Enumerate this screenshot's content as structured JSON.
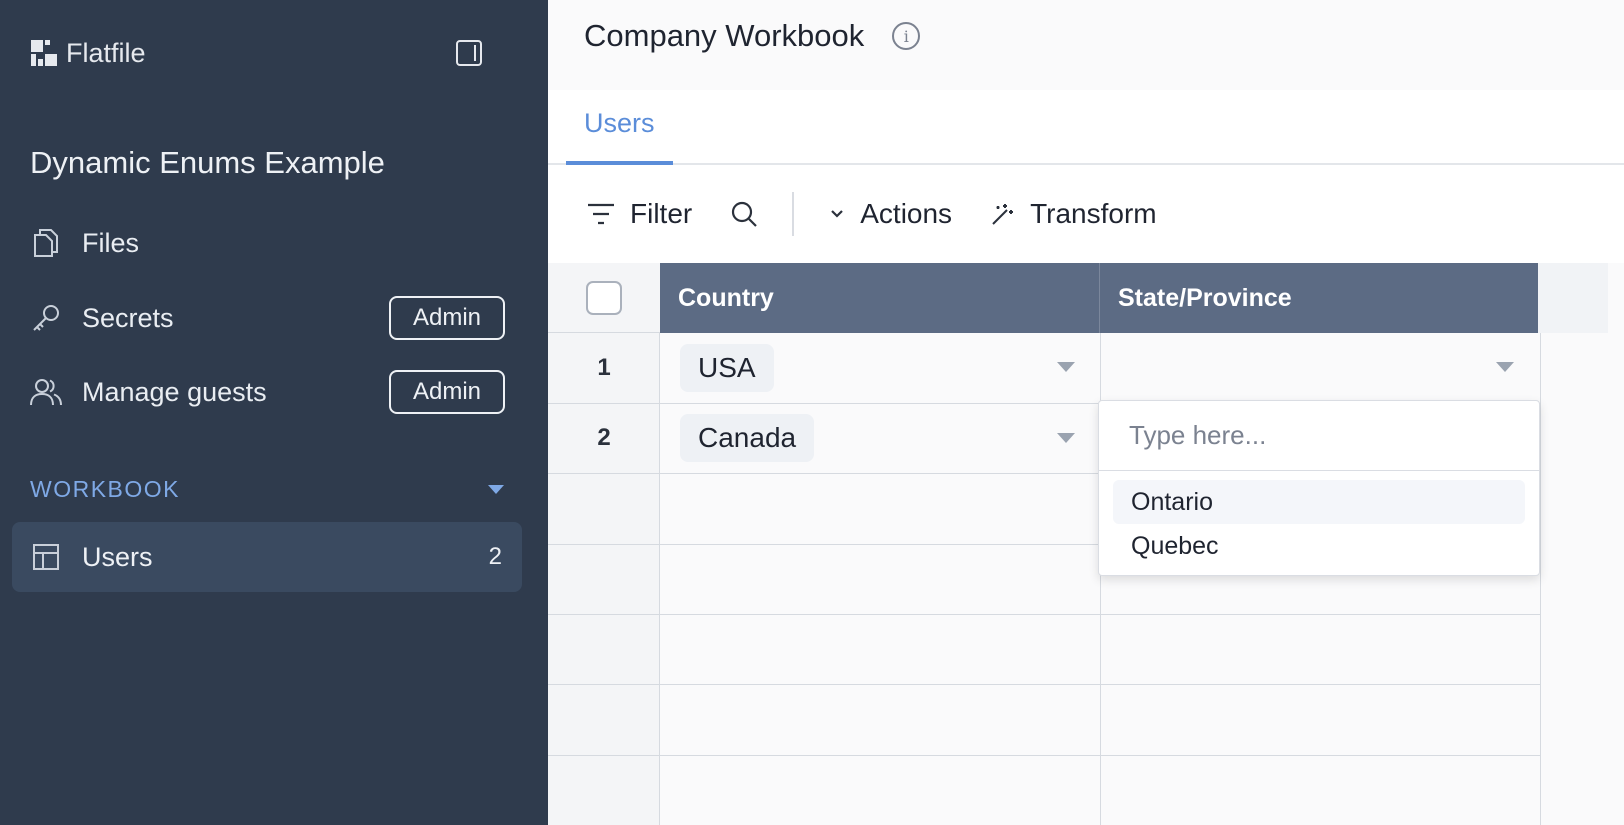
{
  "brand": {
    "name": "Flatfile"
  },
  "sidebar": {
    "space_title": "Dynamic Enums Example",
    "items": [
      {
        "label": "Files",
        "icon": "files-icon"
      },
      {
        "label": "Secrets",
        "icon": "key-icon",
        "badge": "Admin"
      },
      {
        "label": "Manage guests",
        "icon": "users-icon",
        "badge": "Admin"
      }
    ],
    "section": {
      "label": "WORKBOOK"
    },
    "sheets": [
      {
        "label": "Users",
        "count": "2",
        "icon": "table-icon"
      }
    ]
  },
  "header": {
    "title": "Company Workbook"
  },
  "tabs": [
    {
      "label": "Users",
      "active": true
    }
  ],
  "toolbar": {
    "filter": "Filter",
    "actions": "Actions",
    "transform": "Transform"
  },
  "table": {
    "columns": [
      "Country",
      "State/Province"
    ],
    "rows": [
      {
        "num": "1",
        "country": "USA",
        "state": ""
      },
      {
        "num": "2",
        "country": "Canada",
        "state": ""
      }
    ]
  },
  "dropdown": {
    "placeholder": "Type here...",
    "options": [
      "Ontario",
      "Quebec"
    ]
  },
  "colors": {
    "sidebar_bg": "#2f3b4d",
    "accent": "#5b8dd9",
    "header_bg": "#5c6b84"
  }
}
